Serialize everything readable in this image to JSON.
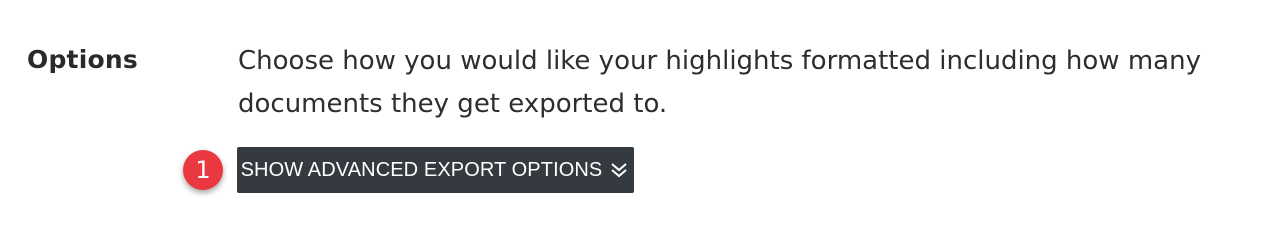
{
  "options": {
    "label": "Options",
    "description": "Choose how you would like your highlights formatted including how many documents they get exported to.",
    "advanced_button_label": "SHOW ADVANCED EXPORT OPTIONS",
    "advanced_button_icon": "double-chevron-down-icon"
  },
  "annotation": {
    "step_number": "1"
  },
  "colors": {
    "button_bg": "#343a40",
    "badge_bg": "#e9383f",
    "text": "#2e2e2e"
  }
}
